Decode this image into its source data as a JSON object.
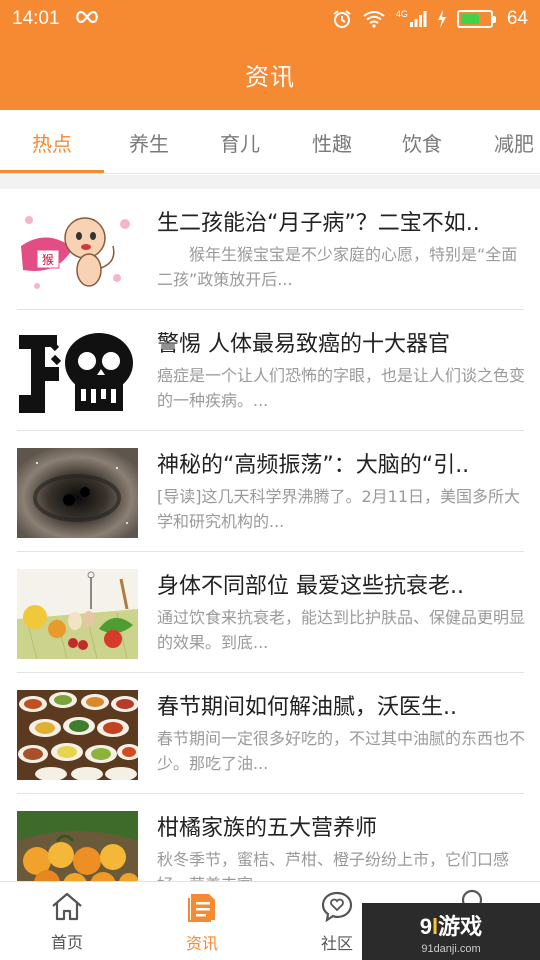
{
  "status_bar": {
    "time": "14:01",
    "network": "4G",
    "battery": "64",
    "battery_level": 0.64,
    "icons": [
      "infinity-icon",
      "alarm-icon",
      "wifi-icon",
      "signal-icon",
      "charging-icon",
      "battery-icon"
    ]
  },
  "header": {
    "title": "资讯"
  },
  "tabs": [
    {
      "label": "热点",
      "active": true
    },
    {
      "label": "养生",
      "active": false
    },
    {
      "label": "育儿",
      "active": false
    },
    {
      "label": "性趣",
      "active": false
    },
    {
      "label": "饮食",
      "active": false
    },
    {
      "label": "减肥",
      "active": false
    }
  ],
  "news": [
    {
      "title": "生二孩能治“月子病”？二宝不如..",
      "summary": "猴年生猴宝宝是不少家庭的心愿，特别是“全面二孩”政策放开后...",
      "image": "monkey-baby-image"
    },
    {
      "title": "警惕 人体最易致癌的十大器官",
      "summary": "癌症是一个让人们恐怖的字眼，也是让人们谈之色变的一种疾病。...",
      "image": "cancer-skull-image"
    },
    {
      "title": "神秘的“高频振荡”：大脑的“引..",
      "summary": "[导读]这几天科学界沸腾了。2月11日，美国多所大学和研究机构的...",
      "image": "black-hole-image"
    },
    {
      "title": "身体不同部位 最爱这些抗衰老..",
      "summary": "通过饮食来抗衰老，能达到比护肤品、保健品更明显的效果。到底...",
      "image": "healthy-food-image"
    },
    {
      "title": "春节期间如何解油腻，沃医生..",
      "summary": "春节期间一定很多好吃的，不过其中油腻的东西也不少。那吃了油...",
      "image": "feast-dishes-image"
    },
    {
      "title": "柑橘家族的五大营养师",
      "summary": "秋冬季节，蜜桔、芦柑、橙子纷纷上市，它们口感好，营养丰富...",
      "image": "citrus-fruits-image"
    }
  ],
  "bottom_nav": [
    {
      "label": "首页",
      "icon": "home-icon",
      "active": false
    },
    {
      "label": "资讯",
      "icon": "news-icon",
      "active": true
    },
    {
      "label": "社区",
      "icon": "community-icon",
      "active": false
    }
  ],
  "watermark": {
    "logo_num": "9",
    "logo_text": "游戏",
    "url": "91danji.com"
  },
  "colors": {
    "accent": "#f58a33",
    "title_text": "#222222",
    "summary_text": "#9a9a9a"
  }
}
